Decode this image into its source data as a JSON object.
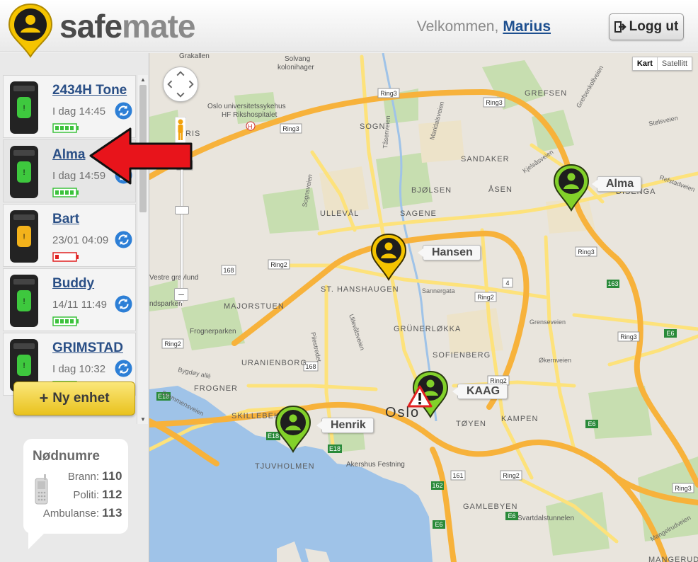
{
  "header": {
    "logo_safe": "safe",
    "logo_mate": "mate",
    "welcome_text": "Velkommen,",
    "user_name": "Marius",
    "logout_label": "Logg ut",
    "logout_icon": "sign-out-icon"
  },
  "devices": [
    {
      "name": "2434H Tone",
      "time": "I dag 14:45",
      "battery": "full",
      "led": "green"
    },
    {
      "name": "Alma",
      "time": "I dag 14:59",
      "battery": "full",
      "led": "green"
    },
    {
      "name": "Bart",
      "time": "23/01 04:09",
      "battery": "low",
      "led": "amber"
    },
    {
      "name": "Buddy",
      "time": "14/11 11:49",
      "battery": "full",
      "led": "green"
    },
    {
      "name": "GRIMSTAD",
      "time": "I dag 10:32",
      "battery": "full",
      "led": "green"
    }
  ],
  "selected_device": "Alma",
  "new_device_label": "Ny enhet",
  "emergency": {
    "title": "Nødnumre",
    "rows": [
      {
        "label": "Brann:",
        "number": "110"
      },
      {
        "label": "Politi:",
        "number": "112"
      },
      {
        "label": "Ambulanse:",
        "number": "113"
      }
    ]
  },
  "map": {
    "type_buttons": [
      "Kart",
      "Satellitt"
    ],
    "active_type": "Kart",
    "markers": [
      {
        "label": "Alma",
        "style": "green"
      },
      {
        "label": "Hansen",
        "style": "yellow"
      },
      {
        "label": "KAAG",
        "style": "green-alert"
      },
      {
        "label": "Henrik",
        "style": "green"
      }
    ],
    "place_labels": [
      "GREFSEN",
      "SOGN",
      "SANDAKER",
      "ÅSEN",
      "BJØLSEN",
      "SAGENE",
      "ULLEVÅL",
      "ST. HANSHAUGEN",
      "MAJORSTUEN",
      "GRÜNERLØKKA",
      "SOFIENBERG",
      "URANIENBORG",
      "FROGNER",
      "SKILLEBEKK",
      "TJUVHOLMEN",
      "TØYEN",
      "KAMPEN",
      "GAMLEBYEN",
      "DISENGA",
      "Oslo",
      "Frognerparken",
      "Akershus Festning",
      "Solvang kolonihager",
      "Oslo universitetssykehus HF Rikshospitalet",
      "Vestre gravlund",
      "Svartdalstunnelen",
      "Grakallen",
      "Sannergata",
      "Grenseveien",
      "Økernveien",
      "Bygdøy allé",
      "Drammensveien",
      "Pilestredet",
      "Ullevålsveien",
      "Kjelsåsveien",
      "Refstadveien",
      "Mangelrudveien",
      "Stølsveien",
      "Sognsveien",
      "Tåsenveien",
      "Maridalsveien",
      "Grefsenkollveien",
      "MANGERUD",
      "RIS",
      "ndsparken"
    ],
    "road_shields": [
      "Ring3",
      "Ring2",
      "E18",
      "E6",
      "168",
      "161",
      "162",
      "163",
      "4"
    ]
  },
  "colors": {
    "brand_yellow": "#f5c400",
    "link_blue": "#2a4f86",
    "battery_green": "#3cc23c",
    "battery_red": "#e02020",
    "arrow_red": "#e8141b",
    "water": "#9fc3e8",
    "park": "#c7deb0",
    "major_road": "#f7b23b",
    "minor_road": "#fde27b"
  }
}
